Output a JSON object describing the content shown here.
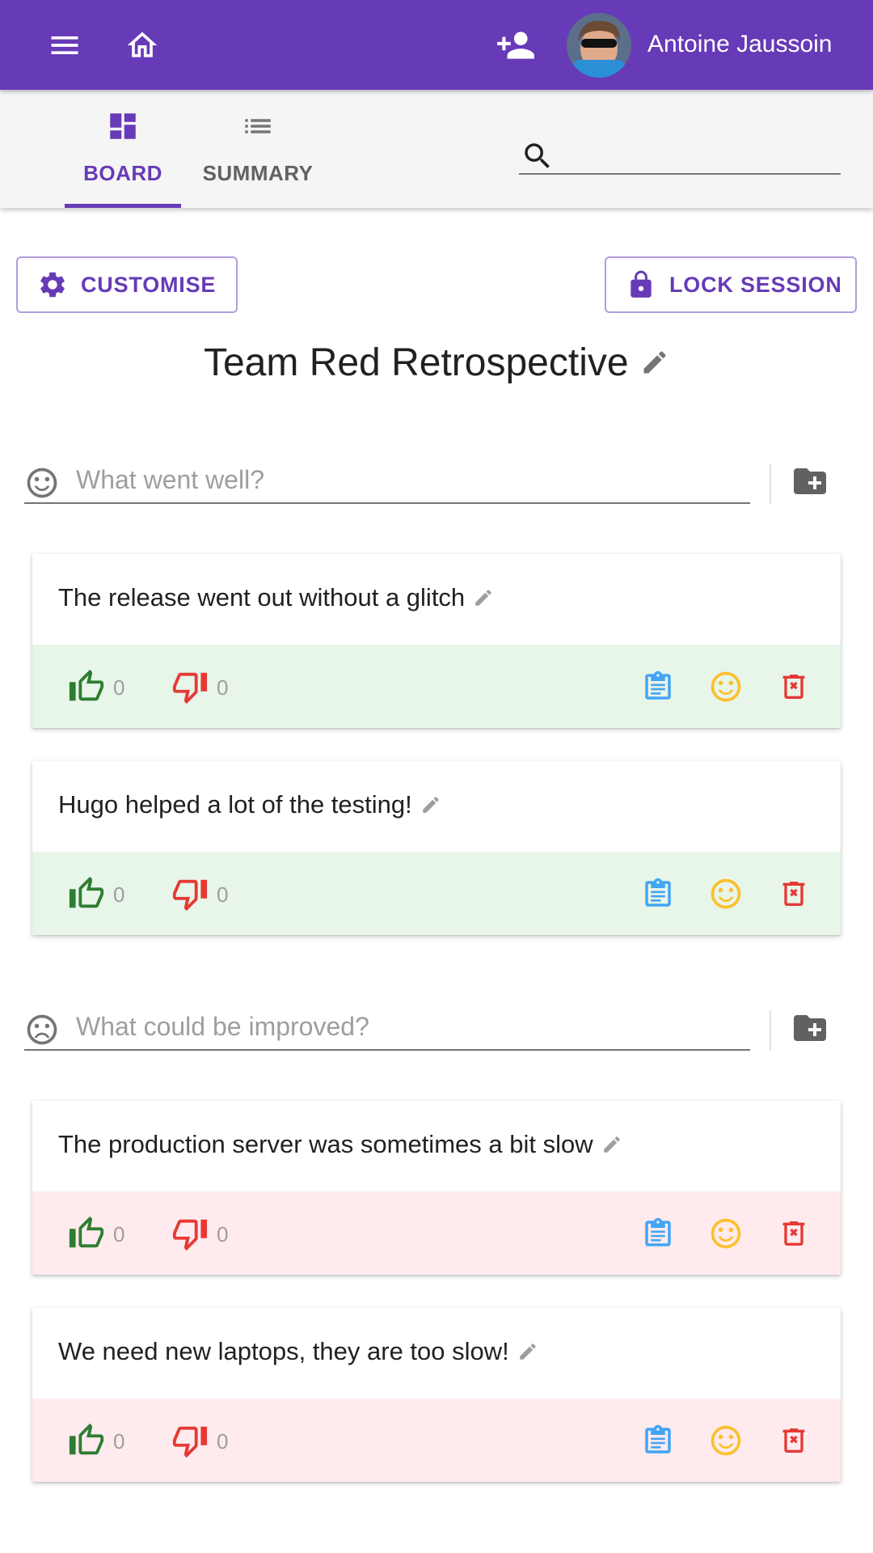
{
  "appbar": {
    "user_name": "Antoine Jaussoin",
    "icons": [
      "menu-icon",
      "home-icon",
      "add-user-icon"
    ],
    "color": "#673ab7"
  },
  "tabs": [
    {
      "label": "BOARD",
      "icon": "dashboard-icon",
      "active": true
    },
    {
      "label": "SUMMARY",
      "icon": "list-icon",
      "active": false
    }
  ],
  "search": {
    "value": "",
    "placeholder": ""
  },
  "toolbar": {
    "customise_label": "CUSTOMISE",
    "lock_label": "LOCK SESSION"
  },
  "session": {
    "title": "Team Red Retrospective"
  },
  "columns": [
    {
      "placeholder": "What went well?",
      "icon": "smile-face-icon",
      "tint": "#e8f5e9",
      "posts": [
        {
          "text": "The release went out without a glitch",
          "likes": "0",
          "dislikes": "0"
        },
        {
          "text": "Hugo helped a lot of the testing!",
          "likes": "0",
          "dislikes": "0"
        }
      ]
    },
    {
      "placeholder": "What could be improved?",
      "icon": "sad-face-icon",
      "tint": "#ffebee",
      "posts": [
        {
          "text": "The production server was sometimes a bit slow",
          "likes": "0",
          "dislikes": "0"
        },
        {
          "text": "We need new laptops, they are too slow!",
          "likes": "0",
          "dislikes": "0"
        }
      ]
    }
  ],
  "colors": {
    "like": "#2e7d32",
    "dislike": "#e53935",
    "copy": "#42a5f5",
    "reaction": "#fbc02d",
    "delete": "#e53935"
  }
}
